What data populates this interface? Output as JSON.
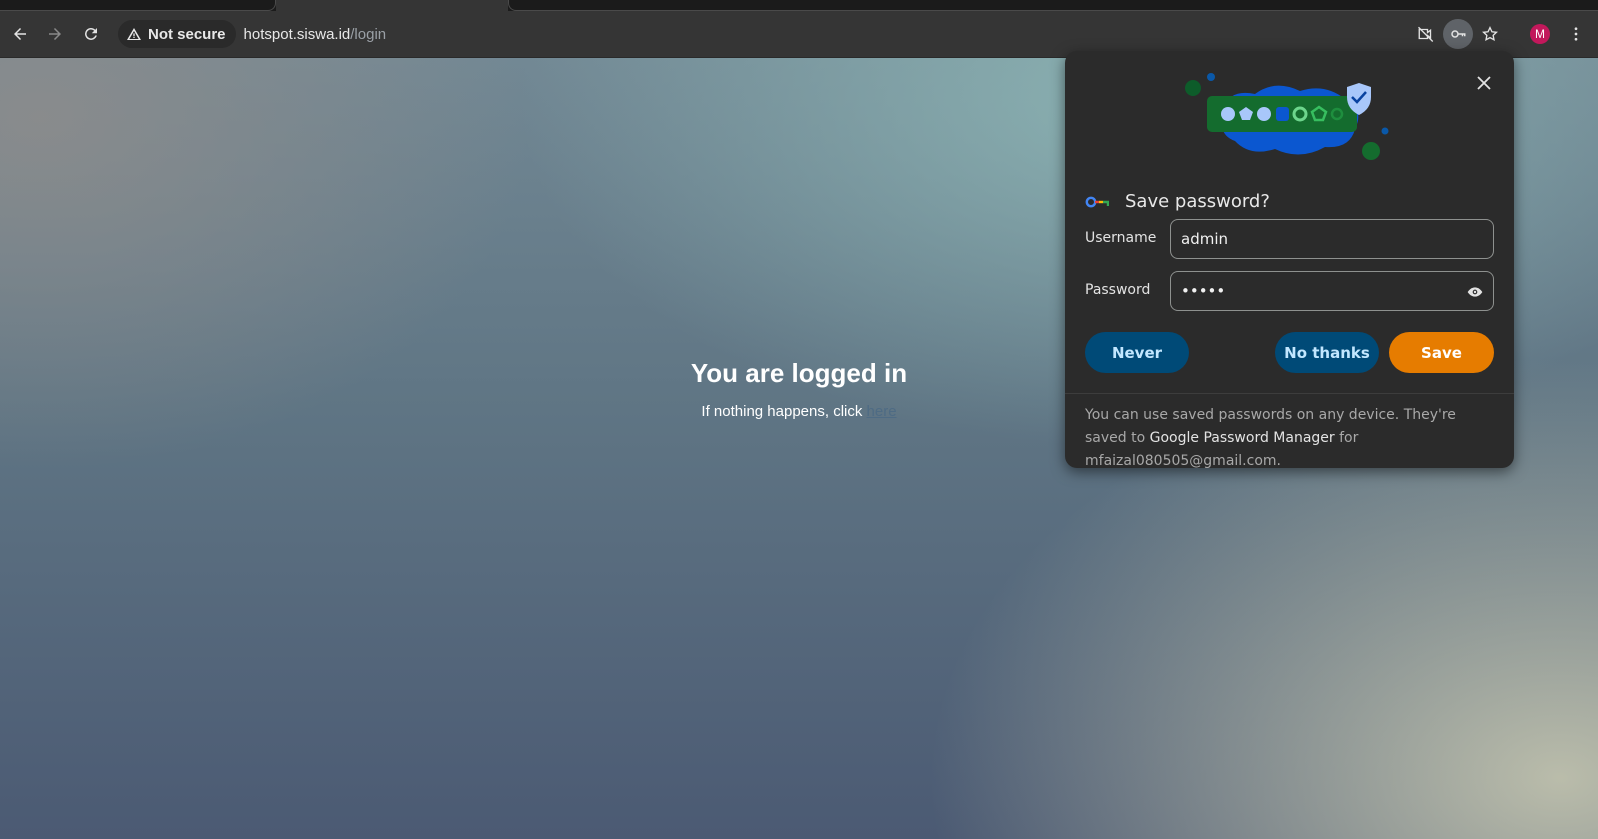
{
  "browser": {
    "security_label": "Not secure",
    "url_host": "hotspot.siswa.id",
    "url_path": "/login",
    "profile_initial": "M"
  },
  "page": {
    "title": "You are logged in",
    "subtitle_prefix": "If nothing happens, click ",
    "subtitle_link": "here"
  },
  "save_password": {
    "title": "Save password?",
    "username_label": "Username",
    "username_value": "admin",
    "password_label": "Password",
    "password_value": "•••••",
    "never_label": "Never",
    "no_thanks_label": "No thanks",
    "save_label": "Save",
    "footer_prefix": "You can use saved passwords on any device. They're saved to ",
    "footer_link": "Google Password Manager",
    "footer_suffix": " for mfaizal080505@gmail.com."
  },
  "colors": {
    "save_button": "#e67c00",
    "secondary_button": "#004a77",
    "bubble_bg": "#2b2b2b",
    "toolbar_bg": "#353535"
  },
  "icons": [
    "back-arrow-icon",
    "forward-arrow-icon",
    "reload-icon",
    "warning-icon",
    "camera-off-icon",
    "key-icon",
    "star-icon",
    "more-vert-icon",
    "close-icon",
    "eye-icon"
  ]
}
